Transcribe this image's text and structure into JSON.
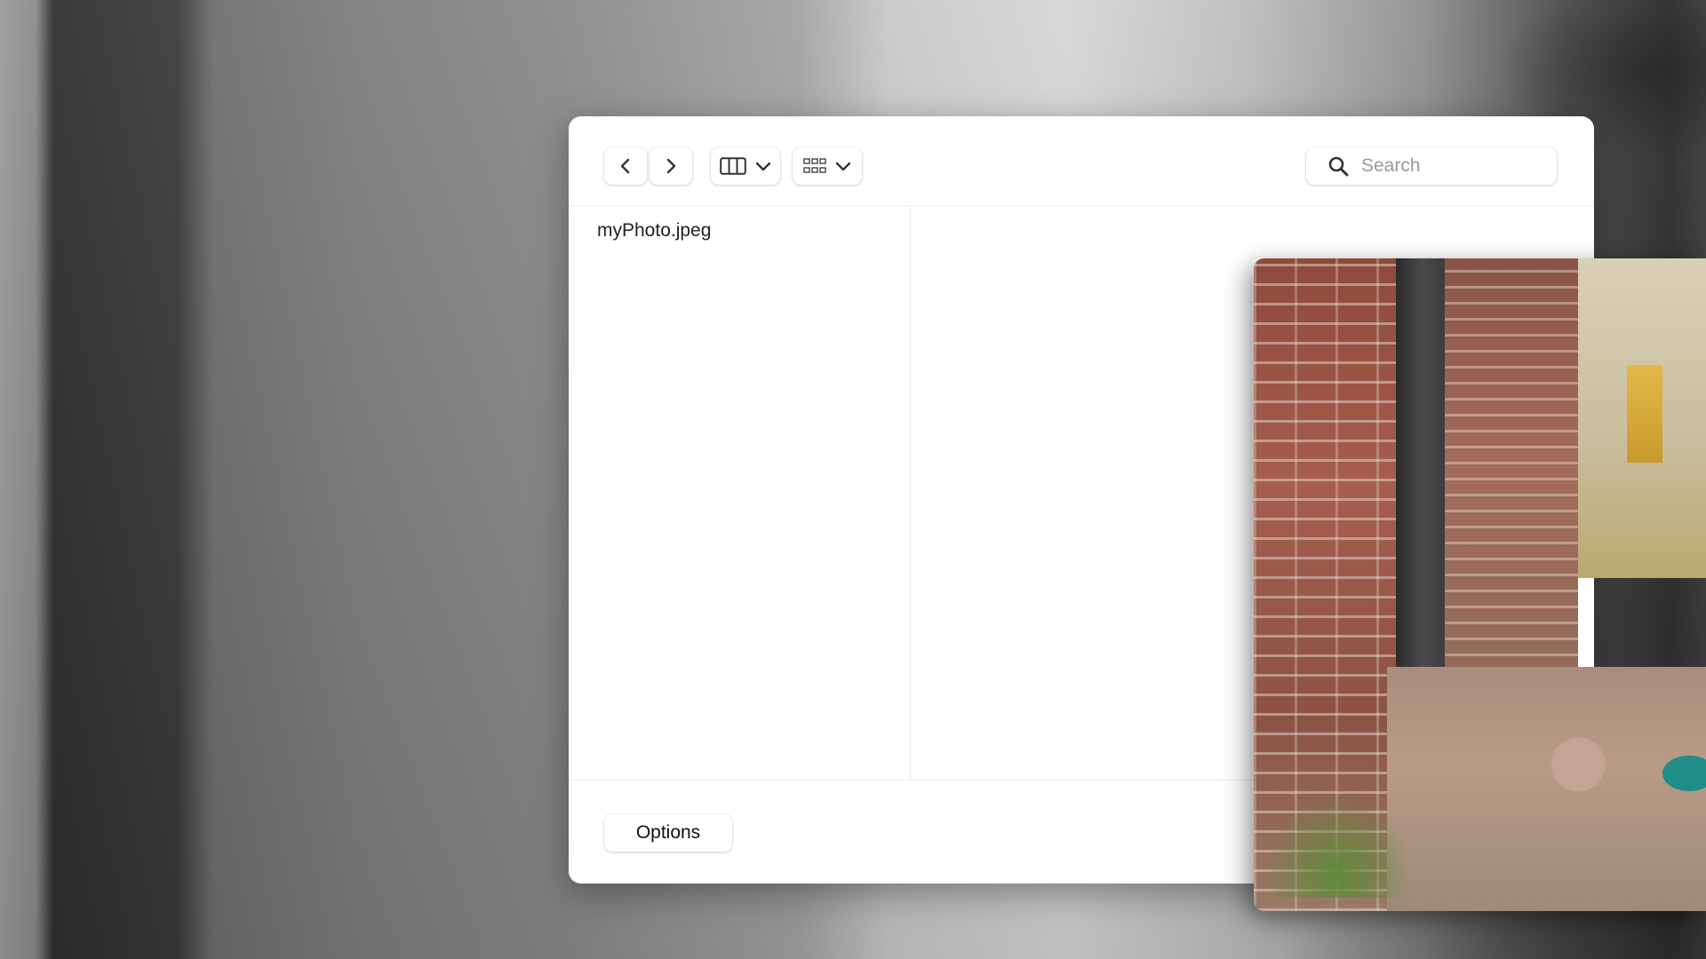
{
  "toolbar": {
    "back_label": "Back",
    "forward_label": "Forward",
    "view_mode_icon": "columns-icon",
    "group_mode_icon": "grid-icon"
  },
  "search": {
    "placeholder": "Search",
    "value": ""
  },
  "sidebar": {
    "items": [
      {
        "label": "myPhoto.jpeg"
      }
    ]
  },
  "footer": {
    "options_label": "Options"
  }
}
